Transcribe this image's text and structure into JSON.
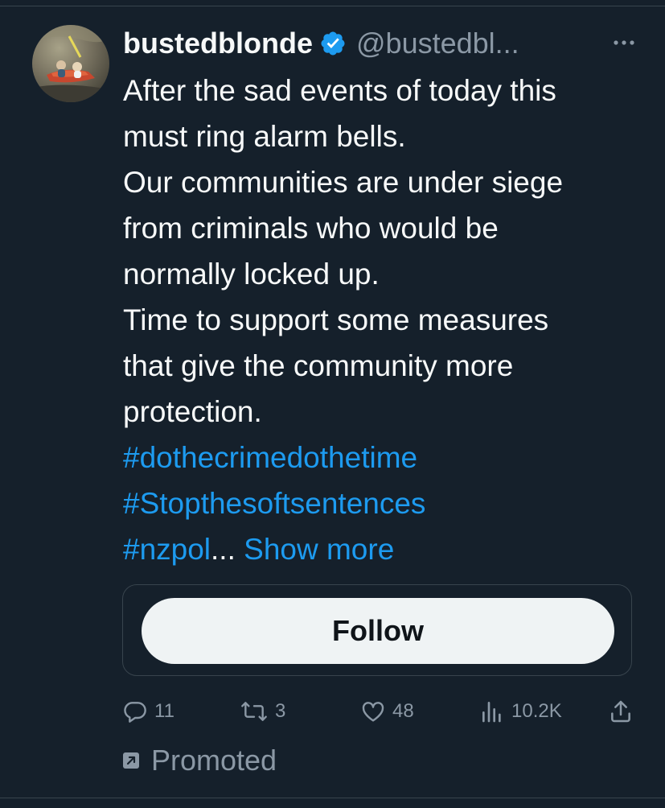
{
  "tweet": {
    "display_name": "bustedblonde",
    "handle": "@bustedbl...",
    "verified": true,
    "lines": [
      "After the sad events of today this",
      "must ring alarm bells.",
      "Our communities are under siege",
      "from criminals who would be",
      "normally locked up.",
      "Time to support some measures",
      "that give the community more",
      "protection."
    ],
    "hashtags": [
      "#dothecrimedothetime",
      "#Stopthesoftsentences",
      "#nzpol"
    ],
    "truncation": "...",
    "show_more": "Show more"
  },
  "follow_button_label": "Follow",
  "actions": {
    "replies": "11",
    "retweets": "3",
    "likes": "48",
    "views": "10.2K"
  },
  "promoted_label": "Promoted",
  "icons": {
    "verified": "verified-badge-icon",
    "more": "more-options-icon",
    "reply": "reply-icon",
    "retweet": "retweet-icon",
    "like": "heart-icon",
    "views": "views-chart-icon",
    "share": "share-icon",
    "promoted": "promoted-arrow-icon"
  },
  "colors": {
    "background": "#15202b",
    "text": "#f7f9f9",
    "muted": "#8b98a5",
    "link": "#1d9bf0",
    "border": "#38444d",
    "follow_bg": "#eff3f4"
  }
}
